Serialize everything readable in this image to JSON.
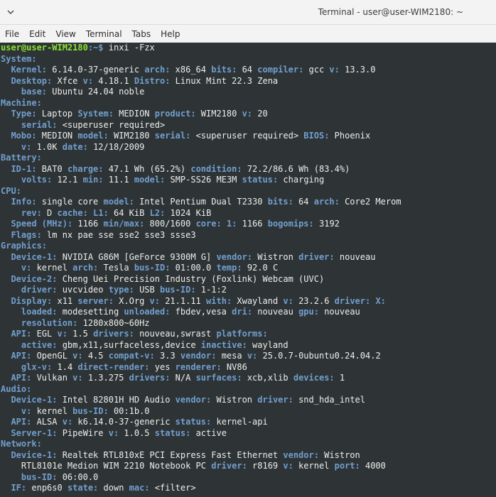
{
  "window": {
    "title": "Terminal - user@user-WIM2180: ~",
    "menu_icon": "chevron-down-icon"
  },
  "menubar": [
    "File",
    "Edit",
    "View",
    "Terminal",
    "Tabs",
    "Help"
  ],
  "prompt": {
    "user_host": "user@user-WIM2180",
    "path": ":~$",
    "command": " inxi -Fzx"
  },
  "lines": [
    [
      [
        "s",
        "System:"
      ]
    ],
    [
      [
        "v",
        "  "
      ],
      [
        "k",
        "Kernel:"
      ],
      [
        "v",
        " 6.14.0-37-generic "
      ],
      [
        "k",
        "arch:"
      ],
      [
        "v",
        " x86_64 "
      ],
      [
        "k",
        "bits:"
      ],
      [
        "v",
        " 64 "
      ],
      [
        "k",
        "compiler:"
      ],
      [
        "v",
        " gcc "
      ],
      [
        "k",
        "v:"
      ],
      [
        "v",
        " 13.3.0"
      ]
    ],
    [
      [
        "v",
        "  "
      ],
      [
        "k",
        "Desktop:"
      ],
      [
        "v",
        " Xfce "
      ],
      [
        "k",
        "v:"
      ],
      [
        "v",
        " 4.18.1 "
      ],
      [
        "k",
        "Distro:"
      ],
      [
        "v",
        " Linux Mint 22.3 Zena"
      ]
    ],
    [
      [
        "v",
        "    "
      ],
      [
        "k",
        "base:"
      ],
      [
        "v",
        " Ubuntu 24.04 noble"
      ]
    ],
    [
      [
        "s",
        "Machine:"
      ]
    ],
    [
      [
        "v",
        "  "
      ],
      [
        "k",
        "Type:"
      ],
      [
        "v",
        " Laptop "
      ],
      [
        "k",
        "System:"
      ],
      [
        "v",
        " MEDION "
      ],
      [
        "k",
        "product:"
      ],
      [
        "v",
        " WIM2180 "
      ],
      [
        "k",
        "v:"
      ],
      [
        "v",
        " 20"
      ]
    ],
    [
      [
        "v",
        "    "
      ],
      [
        "k",
        "serial:"
      ],
      [
        "v",
        " <superuser required>"
      ]
    ],
    [
      [
        "v",
        "  "
      ],
      [
        "k",
        "Mobo:"
      ],
      [
        "v",
        " MEDION "
      ],
      [
        "k",
        "model:"
      ],
      [
        "v",
        " WIM2180 "
      ],
      [
        "k",
        "serial:"
      ],
      [
        "v",
        " <superuser required> "
      ],
      [
        "k",
        "BIOS:"
      ],
      [
        "v",
        " Phoenix"
      ]
    ],
    [
      [
        "v",
        "    "
      ],
      [
        "k",
        "v:"
      ],
      [
        "v",
        " 1.0K "
      ],
      [
        "k",
        "date:"
      ],
      [
        "v",
        " 12/18/2009"
      ]
    ],
    [
      [
        "s",
        "Battery:"
      ]
    ],
    [
      [
        "v",
        "  "
      ],
      [
        "k",
        "ID-1:"
      ],
      [
        "v",
        " BAT0 "
      ],
      [
        "k",
        "charge:"
      ],
      [
        "v",
        " 47.1 Wh (65.2%) "
      ],
      [
        "k",
        "condition:"
      ],
      [
        "v",
        " 72.2/86.6 Wh (83.4%)"
      ]
    ],
    [
      [
        "v",
        "    "
      ],
      [
        "k",
        "volts:"
      ],
      [
        "v",
        " 12.1 "
      ],
      [
        "k",
        "min:"
      ],
      [
        "v",
        " 11.1 "
      ],
      [
        "k",
        "model:"
      ],
      [
        "v",
        " SMP-SS26 ME3M "
      ],
      [
        "k",
        "status:"
      ],
      [
        "v",
        " charging"
      ]
    ],
    [
      [
        "s",
        "CPU:"
      ]
    ],
    [
      [
        "v",
        "  "
      ],
      [
        "k",
        "Info:"
      ],
      [
        "v",
        " single core "
      ],
      [
        "k",
        "model:"
      ],
      [
        "v",
        " Intel Pentium Dual T2330 "
      ],
      [
        "k",
        "bits:"
      ],
      [
        "v",
        " 64 "
      ],
      [
        "k",
        "arch:"
      ],
      [
        "v",
        " Core2 Merom"
      ]
    ],
    [
      [
        "v",
        "    "
      ],
      [
        "k",
        "rev:"
      ],
      [
        "v",
        " D "
      ],
      [
        "k",
        "cache:"
      ],
      [
        "v",
        " "
      ],
      [
        "k",
        "L1:"
      ],
      [
        "v",
        " 64 KiB "
      ],
      [
        "k",
        "L2:"
      ],
      [
        "v",
        " 1024 KiB"
      ]
    ],
    [
      [
        "v",
        "  "
      ],
      [
        "k",
        "Speed (MHz):"
      ],
      [
        "v",
        " 1166 "
      ],
      [
        "k",
        "min/max:"
      ],
      [
        "v",
        " 800/1600 "
      ],
      [
        "k",
        "core:"
      ],
      [
        "v",
        " "
      ],
      [
        "k",
        "1:"
      ],
      [
        "v",
        " 1166 "
      ],
      [
        "k",
        "bogomips:"
      ],
      [
        "v",
        " 3192"
      ]
    ],
    [
      [
        "v",
        "  "
      ],
      [
        "k",
        "Flags:"
      ],
      [
        "v",
        " lm nx pae sse sse2 sse3 ssse3"
      ]
    ],
    [
      [
        "s",
        "Graphics:"
      ]
    ],
    [
      [
        "v",
        "  "
      ],
      [
        "k",
        "Device-1:"
      ],
      [
        "v",
        " NVIDIA G86M [GeForce 9300M G] "
      ],
      [
        "k",
        "vendor:"
      ],
      [
        "v",
        " Wistron "
      ],
      [
        "k",
        "driver:"
      ],
      [
        "v",
        " nouveau"
      ]
    ],
    [
      [
        "v",
        "    "
      ],
      [
        "k",
        "v:"
      ],
      [
        "v",
        " kernel "
      ],
      [
        "k",
        "arch:"
      ],
      [
        "v",
        " Tesla "
      ],
      [
        "k",
        "bus-ID:"
      ],
      [
        "v",
        " 01:00.0 "
      ],
      [
        "k",
        "temp:"
      ],
      [
        "v",
        " 92.0 C"
      ]
    ],
    [
      [
        "v",
        "  "
      ],
      [
        "k",
        "Device-2:"
      ],
      [
        "v",
        " Cheng Uei Precision Industry (Foxlink) Webcam (UVC)"
      ]
    ],
    [
      [
        "v",
        "    "
      ],
      [
        "k",
        "driver:"
      ],
      [
        "v",
        " uvcvideo "
      ],
      [
        "k",
        "type:"
      ],
      [
        "v",
        " USB "
      ],
      [
        "k",
        "bus-ID:"
      ],
      [
        "v",
        " 1-1:2"
      ]
    ],
    [
      [
        "v",
        "  "
      ],
      [
        "k",
        "Display:"
      ],
      [
        "v",
        " x11 "
      ],
      [
        "k",
        "server:"
      ],
      [
        "v",
        " X.Org "
      ],
      [
        "k",
        "v:"
      ],
      [
        "v",
        " 21.1.11 "
      ],
      [
        "k",
        "with:"
      ],
      [
        "v",
        " Xwayland "
      ],
      [
        "k",
        "v:"
      ],
      [
        "v",
        " 23.2.6 "
      ],
      [
        "k",
        "driver:"
      ],
      [
        "v",
        " "
      ],
      [
        "k",
        "X:"
      ]
    ],
    [
      [
        "v",
        "    "
      ],
      [
        "k",
        "loaded:"
      ],
      [
        "v",
        " modesetting "
      ],
      [
        "k",
        "unloaded:"
      ],
      [
        "v",
        " fbdev,vesa "
      ],
      [
        "k",
        "dri:"
      ],
      [
        "v",
        " nouveau "
      ],
      [
        "k",
        "gpu:"
      ],
      [
        "v",
        " nouveau"
      ]
    ],
    [
      [
        "v",
        "    "
      ],
      [
        "k",
        "resolution:"
      ],
      [
        "v",
        " 1280x800~60Hz"
      ]
    ],
    [
      [
        "v",
        "  "
      ],
      [
        "k",
        "API:"
      ],
      [
        "v",
        " EGL "
      ],
      [
        "k",
        "v:"
      ],
      [
        "v",
        " 1.5 "
      ],
      [
        "k",
        "drivers:"
      ],
      [
        "v",
        " nouveau,swrast "
      ],
      [
        "k",
        "platforms:"
      ]
    ],
    [
      [
        "v",
        "    "
      ],
      [
        "k",
        "active:"
      ],
      [
        "v",
        " gbm,x11,surfaceless,device "
      ],
      [
        "k",
        "inactive:"
      ],
      [
        "v",
        " wayland"
      ]
    ],
    [
      [
        "v",
        "  "
      ],
      [
        "k",
        "API:"
      ],
      [
        "v",
        " OpenGL "
      ],
      [
        "k",
        "v:"
      ],
      [
        "v",
        " 4.5 "
      ],
      [
        "k",
        "compat-v:"
      ],
      [
        "v",
        " 3.3 "
      ],
      [
        "k",
        "vendor:"
      ],
      [
        "v",
        " mesa "
      ],
      [
        "k",
        "v:"
      ],
      [
        "v",
        " 25.0.7-0ubuntu0.24.04.2"
      ]
    ],
    [
      [
        "v",
        "    "
      ],
      [
        "k",
        "glx-v:"
      ],
      [
        "v",
        " 1.4 "
      ],
      [
        "k",
        "direct-render:"
      ],
      [
        "v",
        " yes "
      ],
      [
        "k",
        "renderer:"
      ],
      [
        "v",
        " NV86"
      ]
    ],
    [
      [
        "v",
        "  "
      ],
      [
        "k",
        "API:"
      ],
      [
        "v",
        " Vulkan "
      ],
      [
        "k",
        "v:"
      ],
      [
        "v",
        " 1.3.275 "
      ],
      [
        "k",
        "drivers:"
      ],
      [
        "v",
        " N/A "
      ],
      [
        "k",
        "surfaces:"
      ],
      [
        "v",
        " xcb,xlib "
      ],
      [
        "k",
        "devices:"
      ],
      [
        "v",
        " 1"
      ]
    ],
    [
      [
        "s",
        "Audio:"
      ]
    ],
    [
      [
        "v",
        "  "
      ],
      [
        "k",
        "Device-1:"
      ],
      [
        "v",
        " Intel 82801H HD Audio "
      ],
      [
        "k",
        "vendor:"
      ],
      [
        "v",
        " Wistron "
      ],
      [
        "k",
        "driver:"
      ],
      [
        "v",
        " snd_hda_intel"
      ]
    ],
    [
      [
        "v",
        "    "
      ],
      [
        "k",
        "v:"
      ],
      [
        "v",
        " kernel "
      ],
      [
        "k",
        "bus-ID:"
      ],
      [
        "v",
        " 00:1b.0"
      ]
    ],
    [
      [
        "v",
        "  "
      ],
      [
        "k",
        "API:"
      ],
      [
        "v",
        " ALSA "
      ],
      [
        "k",
        "v:"
      ],
      [
        "v",
        " k6.14.0-37-generic "
      ],
      [
        "k",
        "status:"
      ],
      [
        "v",
        " kernel-api"
      ]
    ],
    [
      [
        "v",
        "  "
      ],
      [
        "k",
        "Server-1:"
      ],
      [
        "v",
        " PipeWire "
      ],
      [
        "k",
        "v:"
      ],
      [
        "v",
        " 1.0.5 "
      ],
      [
        "k",
        "status:"
      ],
      [
        "v",
        " active"
      ]
    ],
    [
      [
        "s",
        "Network:"
      ]
    ],
    [
      [
        "v",
        "  "
      ],
      [
        "k",
        "Device-1:"
      ],
      [
        "v",
        " Realtek RTL810xE PCI Express Fast Ethernet "
      ],
      [
        "k",
        "vendor:"
      ],
      [
        "v",
        " Wistron"
      ]
    ],
    [
      [
        "v",
        "    RTL8101e Medion WIM 2210 Notebook PC "
      ],
      [
        "k",
        "driver:"
      ],
      [
        "v",
        " r8169 "
      ],
      [
        "k",
        "v:"
      ],
      [
        "v",
        " kernel "
      ],
      [
        "k",
        "port:"
      ],
      [
        "v",
        " 4000"
      ]
    ],
    [
      [
        "v",
        "    "
      ],
      [
        "k",
        "bus-ID:"
      ],
      [
        "v",
        " 06:00.0"
      ]
    ],
    [
      [
        "v",
        "  "
      ],
      [
        "k",
        "IF:"
      ],
      [
        "v",
        " enp6s0 "
      ],
      [
        "k",
        "state:"
      ],
      [
        "v",
        " down "
      ],
      [
        "k",
        "mac:"
      ],
      [
        "v",
        " <filter>"
      ]
    ]
  ]
}
